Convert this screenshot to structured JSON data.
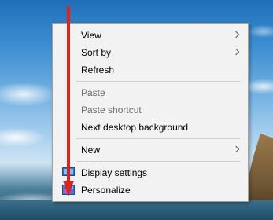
{
  "desktop": {
    "context_menu": {
      "items": [
        {
          "label": "View",
          "has_submenu": true,
          "enabled": true
        },
        {
          "label": "Sort by",
          "has_submenu": true,
          "enabled": true
        },
        {
          "label": "Refresh",
          "has_submenu": false,
          "enabled": true
        },
        {
          "label": "Paste",
          "has_submenu": false,
          "enabled": false
        },
        {
          "label": "Paste shortcut",
          "has_submenu": false,
          "enabled": false
        },
        {
          "label": "Next desktop background",
          "has_submenu": false,
          "enabled": true
        },
        {
          "label": "New",
          "has_submenu": true,
          "enabled": true
        },
        {
          "label": "Display settings",
          "icon": "display-settings-icon",
          "enabled": true
        },
        {
          "label": "Personalize",
          "icon": "personalize-icon",
          "enabled": true
        }
      ]
    },
    "annotation": {
      "type": "arrow",
      "color": "#d9231d",
      "points_to": "Personalize"
    }
  }
}
